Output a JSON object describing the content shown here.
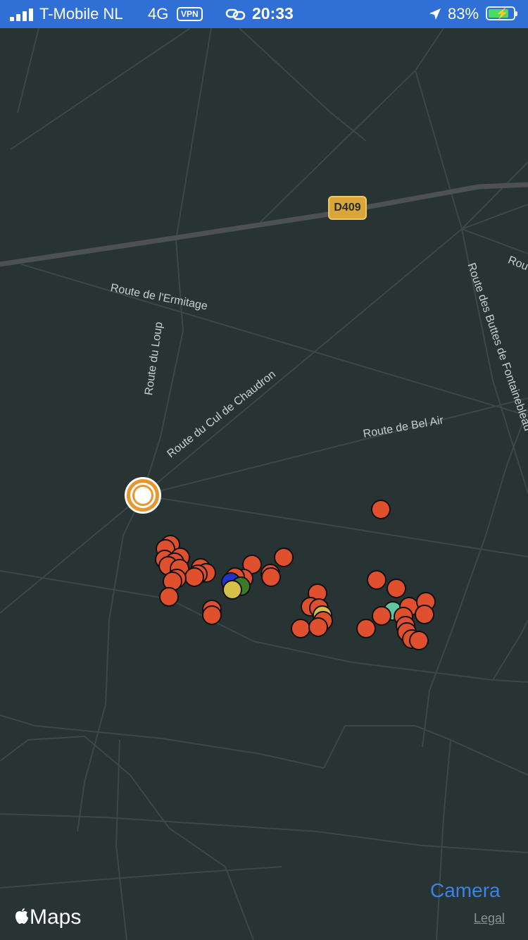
{
  "status_bar": {
    "carrier": "T-Mobile NL",
    "network": "4G",
    "vpn": "VPN",
    "time": "20:33",
    "battery_percent": "83%",
    "battery_level": 0.83,
    "signal_bars": 4
  },
  "map": {
    "route_shield": "D409",
    "road_labels": [
      "Route de l'Ermitage",
      "Route du Loup",
      "Route du Cul de Chaudron",
      "Route de Bel Air",
      "Route des Buttes de Fontainebleau",
      "Rou"
    ],
    "marker_colors": {
      "red": "#e0502e",
      "blue": "#2233cc",
      "green": "#3f7a2a",
      "yellow": "#d7c04a",
      "teal": "#5fc6a0"
    },
    "user_location_color": "#e8962f",
    "background_color": "#283333"
  },
  "controls": {
    "camera_label": "Camera",
    "legal_label": "Legal",
    "attribution": "Maps"
  }
}
